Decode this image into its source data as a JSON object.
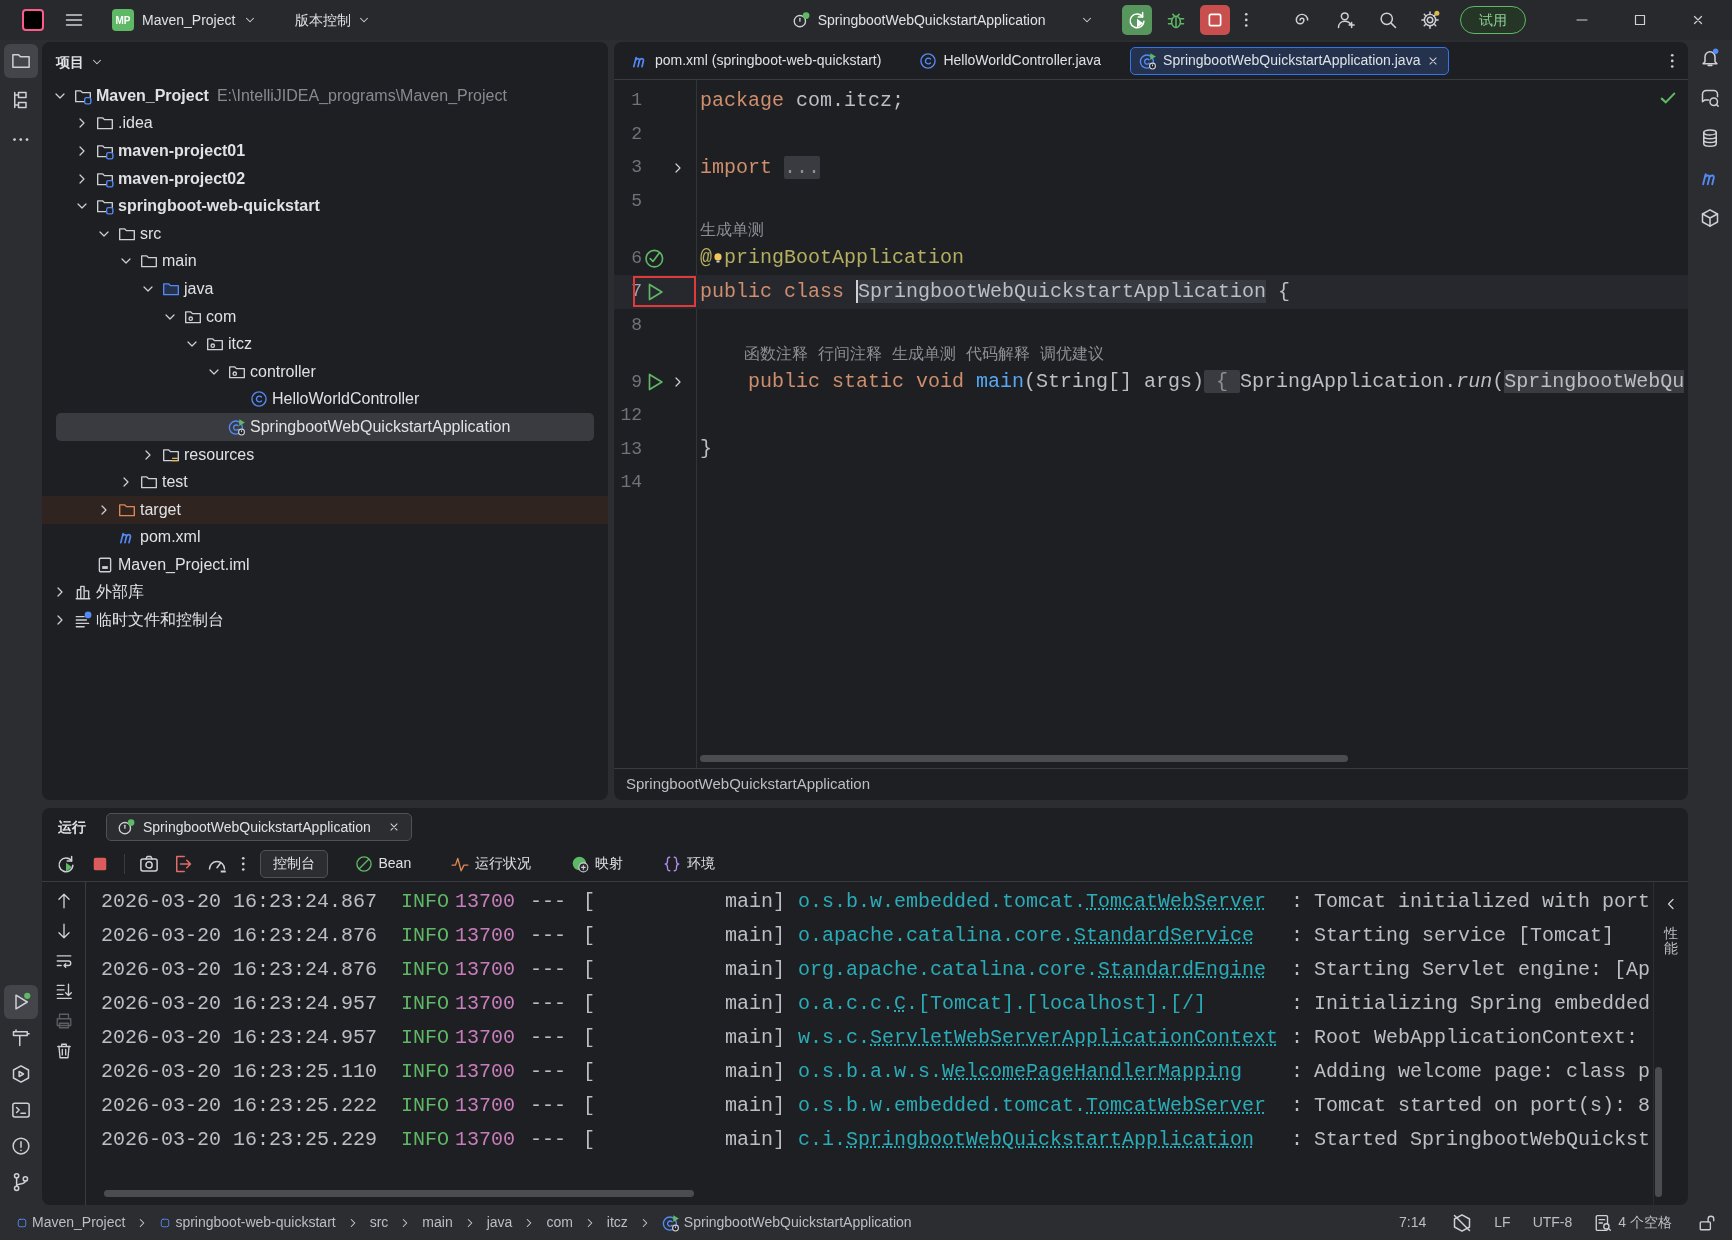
{
  "title_bar": {
    "project_badge": "MP",
    "project": "Maven_Project",
    "vcs": "版本控制",
    "run_config": "SpringbootWebQuickstartApplication",
    "trial": "试用"
  },
  "tool_strip": {
    "top": [
      {
        "kind": "project",
        "selected": true
      },
      {
        "kind": "structure",
        "selected": false
      },
      {
        "kind": "more",
        "selected": false
      }
    ],
    "bottom": [
      {
        "kind": "run",
        "selected": true
      },
      {
        "kind": "build",
        "selected": false
      },
      {
        "kind": "services",
        "selected": false
      },
      {
        "kind": "terminal",
        "selected": false
      },
      {
        "kind": "problems",
        "selected": false
      },
      {
        "kind": "git",
        "selected": false
      }
    ]
  },
  "right_strip": [
    {
      "kind": "notifications"
    },
    {
      "kind": "ai_chat"
    },
    {
      "kind": "database"
    },
    {
      "kind": "maven"
    },
    {
      "kind": "plugin"
    }
  ],
  "project_panel": {
    "title": "项目",
    "tree": [
      {
        "label": "Maven_Project",
        "kind": "module",
        "bold": true,
        "path": "E:\\IntelliJIDEA_programs\\Maven_Project",
        "expanded": true,
        "selected": false,
        "children": [
          {
            "label": ".idea",
            "kind": "folder",
            "expanded": false,
            "selected": false
          },
          {
            "label": "maven-project01",
            "kind": "module",
            "bold": true,
            "expanded": false,
            "selected": false
          },
          {
            "label": "maven-project02",
            "kind": "module",
            "bold": true,
            "expanded": false,
            "selected": false
          },
          {
            "label": "springboot-web-quickstart",
            "kind": "module",
            "bold": true,
            "expanded": true,
            "selected": false,
            "children": [
              {
                "label": "src",
                "kind": "folder",
                "expanded": true,
                "selected": false,
                "children": [
                  {
                    "label": "main",
                    "kind": "folder",
                    "expanded": true,
                    "selected": false,
                    "children": [
                      {
                        "label": "java",
                        "kind": "source",
                        "expanded": true,
                        "selected": false,
                        "children": [
                          {
                            "label": "com",
                            "kind": "package",
                            "expanded": true,
                            "selected": false,
                            "children": [
                              {
                                "label": "itcz",
                                "kind": "package",
                                "expanded": true,
                                "selected": false,
                                "children": [
                                  {
                                    "label": "controller",
                                    "kind": "package",
                                    "expanded": true,
                                    "selected": false,
                                    "children": [
                                      {
                                        "label": "HelloWorldController",
                                        "kind": "class",
                                        "selected": false
                                      }
                                    ]
                                  },
                                  {
                                    "label": "SpringbootWebQuickstartApplication",
                                    "kind": "app",
                                    "selected": true
                                  }
                                ]
                              }
                            ]
                          }
                        ]
                      },
                      {
                        "label": "resources",
                        "kind": "resources",
                        "expanded": false,
                        "selected": false
                      }
                    ]
                  },
                  {
                    "label": "test",
                    "kind": "folder",
                    "expanded": false,
                    "selected": false
                  }
                ]
              },
              {
                "label": "target",
                "kind": "excluded",
                "expanded": false,
                "selected": false
              },
              {
                "label": "pom.xml",
                "kind": "maven",
                "selected": false
              }
            ]
          },
          {
            "label": "Maven_Project.iml",
            "kind": "iml",
            "selected": false
          }
        ]
      },
      {
        "label": "外部库",
        "kind": "library",
        "expanded": false,
        "selected": false
      },
      {
        "label": "临时文件和控制台",
        "kind": "scratch",
        "expanded": false,
        "selected": false
      }
    ]
  },
  "editor": {
    "tabs": [
      {
        "label": "pom.xml (springboot-web-quickstart)",
        "kind": "maven",
        "selected": false
      },
      {
        "label": "HelloWorldController.java",
        "kind": "class",
        "selected": false
      },
      {
        "label": "SpringbootWebQuickstartApplication.java",
        "kind": "app",
        "selected": true
      }
    ],
    "lines": [
      {
        "number": "1",
        "tokens": [
          {
            "kind": "keyword",
            "text": "package"
          },
          {
            "kind": "plain",
            "text": " com.itcz;"
          }
        ]
      },
      {
        "number": "2"
      },
      {
        "number": "3",
        "fold": true,
        "tokens": [
          {
            "kind": "keyword",
            "text": "import "
          },
          {
            "kind": "fold",
            "text": "..."
          }
        ]
      },
      {
        "number": "5"
      },
      {
        "kind": "hints",
        "indent": false,
        "hints": [
          "生成单测"
        ]
      },
      {
        "number": "6",
        "bean_marker": true,
        "tokens": [
          {
            "kind": "annotation",
            "text": "@"
          },
          {
            "kind": "bulb"
          },
          {
            "kind": "annotation",
            "text": "pringBootApplication"
          }
        ]
      },
      {
        "number": "7",
        "run_marker": true,
        "current": true,
        "marked": true,
        "tokens": [
          {
            "kind": "keyword",
            "text": "public class "
          },
          {
            "kind": "caret_highlight",
            "text": "SpringbootWebQuickstartApplication"
          },
          {
            "kind": "plain",
            "text": " {"
          }
        ]
      },
      {
        "number": "8"
      },
      {
        "kind": "hints",
        "indent": true,
        "hints": [
          "函数注释",
          "行间注释",
          "生成单测",
          "代码解释",
          "调优建议"
        ]
      },
      {
        "number": "9",
        "run_marker": true,
        "fold": true,
        "tokens": [
          {
            "kind": "keyword",
            "text": "    public static void "
          },
          {
            "kind": "method",
            "text": "main"
          },
          {
            "kind": "plain",
            "text": "(String[] args)"
          },
          {
            "kind": "fold",
            "text": " { "
          },
          {
            "kind": "plain",
            "text": "SpringApplication."
          },
          {
            "kind": "italic",
            "text": "run"
          },
          {
            "kind": "plain",
            "text": "("
          },
          {
            "kind": "highlight",
            "text": "SpringbootWebQu"
          }
        ]
      },
      {
        "number": "12"
      },
      {
        "number": "13",
        "tokens": [
          {
            "kind": "plain",
            "text": "}"
          }
        ]
      },
      {
        "number": "14"
      }
    ],
    "breadcrumb": "SpringbootWebQuickstartApplication"
  },
  "run_panel": {
    "title": "运行",
    "tab": "SpringbootWebQuickstartApplication",
    "views": [
      {
        "label": "控制台",
        "kind": "console",
        "selected": true
      },
      {
        "label": "Bean",
        "kind": "bean",
        "selected": false
      },
      {
        "label": "运行状况",
        "kind": "health",
        "selected": false
      },
      {
        "label": "映射",
        "kind": "mappings",
        "selected": false
      },
      {
        "label": "环境",
        "kind": "environment",
        "selected": false
      }
    ],
    "log": [
      {
        "time": "2026-03-20 16:23:24.867",
        "level": "INFO",
        "pid": "13700",
        "sep": "---",
        "bracket": "[",
        "thread": "main]",
        "logger": "o.s.b.w.embedded.tomcat.",
        "logger_link": "TomcatWebServer",
        "colon": ":",
        "message": "Tomcat initialized with port"
      },
      {
        "time": "2026-03-20 16:23:24.876",
        "level": "INFO",
        "pid": "13700",
        "sep": "---",
        "bracket": "[",
        "thread": "main]",
        "logger": "o.apache.catalina.core.",
        "logger_link": "StandardService",
        "colon": ":",
        "message": "Starting service [Tomcat]"
      },
      {
        "time": "2026-03-20 16:23:24.876",
        "level": "INFO",
        "pid": "13700",
        "sep": "---",
        "bracket": "[",
        "thread": "main]",
        "logger": "org.apache.catalina.core.",
        "logger_link": "StandardEngine",
        "colon": ":",
        "message": "Starting Servlet engine: [Ap"
      },
      {
        "time": "2026-03-20 16:23:24.957",
        "level": "INFO",
        "pid": "13700",
        "sep": "---",
        "bracket": "[",
        "thread": "main]",
        "logger": "o.a.c.c.",
        "logger_link": "C",
        "logger_suffix": ".[Tomcat].[localhost].[/]",
        "colon": ":",
        "message": "Initializing Spring embedded"
      },
      {
        "time": "2026-03-20 16:23:24.957",
        "level": "INFO",
        "pid": "13700",
        "sep": "---",
        "bracket": "[",
        "thread": "main]",
        "logger": "w.s.c.",
        "logger_link": "ServletWebServerApplicationContext",
        "colon": ":",
        "message": "Root WebApplicationContext:"
      },
      {
        "time": "2026-03-20 16:23:25.110",
        "level": "INFO",
        "pid": "13700",
        "sep": "---",
        "bracket": "[",
        "thread": "main]",
        "logger": "o.s.b.a.w.s.",
        "logger_link": "WelcomePageHandlerMapping",
        "colon": ":",
        "message": "Adding welcome page: class p"
      },
      {
        "time": "2026-03-20 16:23:25.222",
        "level": "INFO",
        "pid": "13700",
        "sep": "---",
        "bracket": "[",
        "thread": "main]",
        "logger": "o.s.b.w.embedded.tomcat.",
        "logger_link": "TomcatWebServer",
        "colon": ":",
        "message": "Tomcat started on port(s): 8"
      },
      {
        "time": "2026-03-20 16:23:25.229",
        "level": "INFO",
        "pid": "13700",
        "sep": "---",
        "bracket": "[",
        "thread": "main]",
        "logger": "c.i.",
        "logger_link": "SpringbootWebQuickstartApplication",
        "colon": ":",
        "message": "Started SpringbootWebQuickst"
      }
    ],
    "side_tab": "性能"
  },
  "status_bar": {
    "path": [
      {
        "label": "Maven_Project",
        "kind": "module"
      },
      {
        "label": "springboot-web-quickstart",
        "kind": "module"
      },
      {
        "label": "src",
        "kind": "plain"
      },
      {
        "label": "main",
        "kind": "plain"
      },
      {
        "label": "java",
        "kind": "plain"
      },
      {
        "label": "com",
        "kind": "plain"
      },
      {
        "label": "itcz",
        "kind": "plain"
      },
      {
        "label": "SpringbootWebQuickstartApplication",
        "kind": "app"
      }
    ],
    "position": "7:14",
    "line_ending": "LF",
    "encoding": "UTF-8",
    "indent": "4 个空格"
  }
}
